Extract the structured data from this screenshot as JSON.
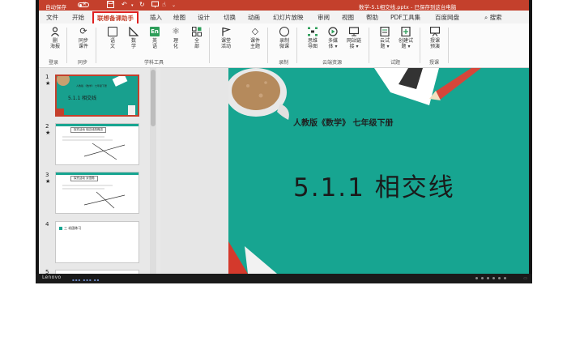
{
  "titlebar": {
    "autosave_label": "自动保存",
    "toggle_state": "关",
    "doc_title": "数学-5.1相交线.pptx - 已保存到这台电脑"
  },
  "menu": {
    "tabs": [
      "文件",
      "开始",
      "联想备课助手",
      "插入",
      "绘图",
      "设计",
      "切换",
      "动画",
      "幻灯片放映",
      "审阅",
      "视图",
      "帮助",
      "PDF工具集",
      "百度网盘"
    ],
    "active_tab": "联想备课助手",
    "search_label": "搜索"
  },
  "ribbon": {
    "buttons": [
      {
        "label": "删\n海报",
        "icon": "person-icon"
      },
      {
        "label": "同步\n课件",
        "icon": "sync-icon"
      },
      {
        "label": "语\n文",
        "icon": "book-icon"
      },
      {
        "label": "数\n学",
        "icon": "triangle-ruler-icon"
      },
      {
        "label": "英\n语",
        "icon": "english-icon",
        "icon_text": "En"
      },
      {
        "label": "理\n化",
        "icon": "atom-icon"
      },
      {
        "label": "全\n部",
        "icon": "grid-icon"
      },
      {
        "label": "课堂\n活动",
        "icon": "flag-icon"
      },
      {
        "label": "课件\n主题",
        "icon": "diamond-icon"
      },
      {
        "label": "录制\n微课",
        "icon": "record-icon"
      },
      {
        "label": "思维\n导图",
        "icon": "mindmap-icon"
      },
      {
        "label": "多媒\n体 ▾",
        "icon": "media-icon"
      },
      {
        "label": "网站链\n接 ▾",
        "icon": "web-link-icon"
      },
      {
        "label": "云试\n题 ▾",
        "icon": "cloud-quiz-icon"
      },
      {
        "label": "创建试\n题 ▾",
        "icon": "create-quiz-icon"
      },
      {
        "label": "授课\n预演",
        "icon": "rehearse-icon"
      }
    ],
    "groups": [
      "登录",
      "同步",
      "学科工具",
      "录制",
      "云端资源",
      "试题",
      "授课"
    ]
  },
  "thumbnails": {
    "items": [
      {
        "number": "1",
        "star": "★",
        "caption": "5.1.1  相交线"
      },
      {
        "number": "2",
        "star": "★",
        "caption": "探究活动 相交线的概念"
      },
      {
        "number": "3",
        "star": "★",
        "caption": "探究活动 对顶角"
      },
      {
        "number": "4",
        "star": "",
        "caption": "三 巩固练习"
      },
      {
        "number": "5",
        "star": "",
        "caption": ""
      }
    ],
    "slide1_header": "人教版 《数学》 七年级下册"
  },
  "slide": {
    "subtitle": "人教版《数学》  七年级下册",
    "title": "5.1.1    相交线"
  },
  "monitor": {
    "brand": "Lenovo"
  },
  "colors": {
    "titlebar": "#c4402c",
    "slide_bg": "#17a591",
    "active_tab_border": "#e02020"
  }
}
